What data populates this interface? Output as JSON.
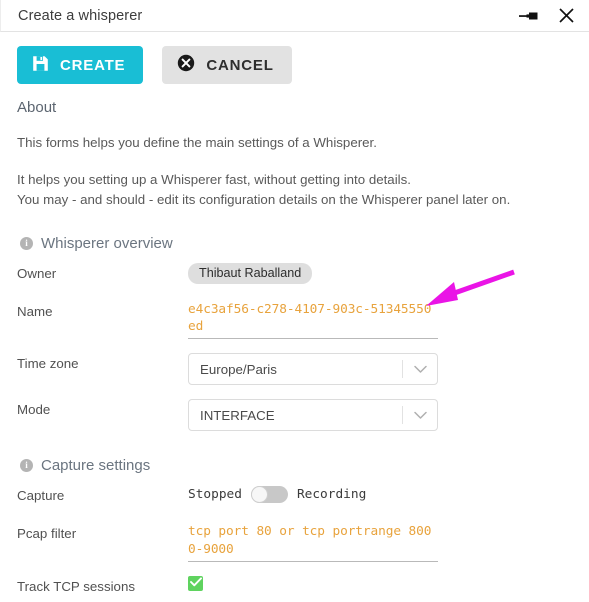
{
  "window": {
    "title": "Create a whisperer",
    "pin_icon": "pin-icon",
    "close_icon": "close-icon"
  },
  "toolbar": {
    "create_label": "CREATE",
    "create_icon": "save-floppy-icon",
    "cancel_label": "CANCEL",
    "cancel_icon": "circle-x-icon",
    "create_color": "#19bed5",
    "cancel_color": "#e2e2e2"
  },
  "about": {
    "heading": "About",
    "paragraph1": "This forms helps you define the main settings of a Whisperer.",
    "paragraph2_line1": "It helps you setting up a Whisperer fast, without getting into details.",
    "paragraph2_line2": "You may - and should - edit its configuration details on the Whisperer panel later on."
  },
  "overview": {
    "heading": "Whisperer overview",
    "info_icon": "info-icon",
    "owner_label": "Owner",
    "owner_value": "Thibaut Raballand",
    "name_label": "Name",
    "name_value": "e4c3af56-c278-4107-903c-51345550ed",
    "timezone_label": "Time zone",
    "timezone_value": "Europe/Paris",
    "mode_label": "Mode",
    "mode_value": "INTERFACE",
    "caret_icon": "chevron-down-icon",
    "value_color": "#e8a33d"
  },
  "capture": {
    "heading": "Capture settings",
    "info_icon": "info-icon",
    "capture_label": "Capture",
    "toggle_off_label": "Stopped",
    "toggle_on_label": "Recording",
    "toggle_state": "Stopped",
    "pcap_label": "Pcap filter",
    "pcap_value": "tcp port 80 or tcp portrange 8000-9000",
    "track_label": "Track TCP sessions",
    "track_checked": true,
    "check_icon": "checkmark-icon",
    "check_color": "#5fd35f"
  },
  "annotation": {
    "arrow_icon": "pointer-arrow-icon",
    "color": "#ea14e6"
  }
}
